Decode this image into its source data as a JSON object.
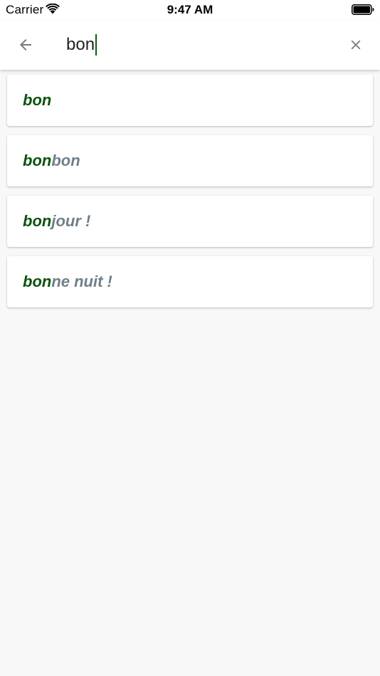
{
  "status_bar": {
    "carrier": "Carrier",
    "time": "9:47 AM",
    "wifi_icon": "wifi-icon",
    "battery_icon": "battery-icon"
  },
  "search": {
    "back_icon": "arrow-left-icon",
    "value": "bon",
    "clear_icon": "close-icon"
  },
  "results": [
    {
      "match": "bon",
      "rest": ""
    },
    {
      "match": "bon",
      "rest": "bon"
    },
    {
      "match": "bon",
      "rest": "jour !"
    },
    {
      "match": "bon",
      "rest": "ne nuit !"
    }
  ],
  "colors": {
    "match_text": "#0b520d",
    "rest_text": "#6e7f8a",
    "caret": "#0b5e0f",
    "background": "#f8f8f8"
  }
}
